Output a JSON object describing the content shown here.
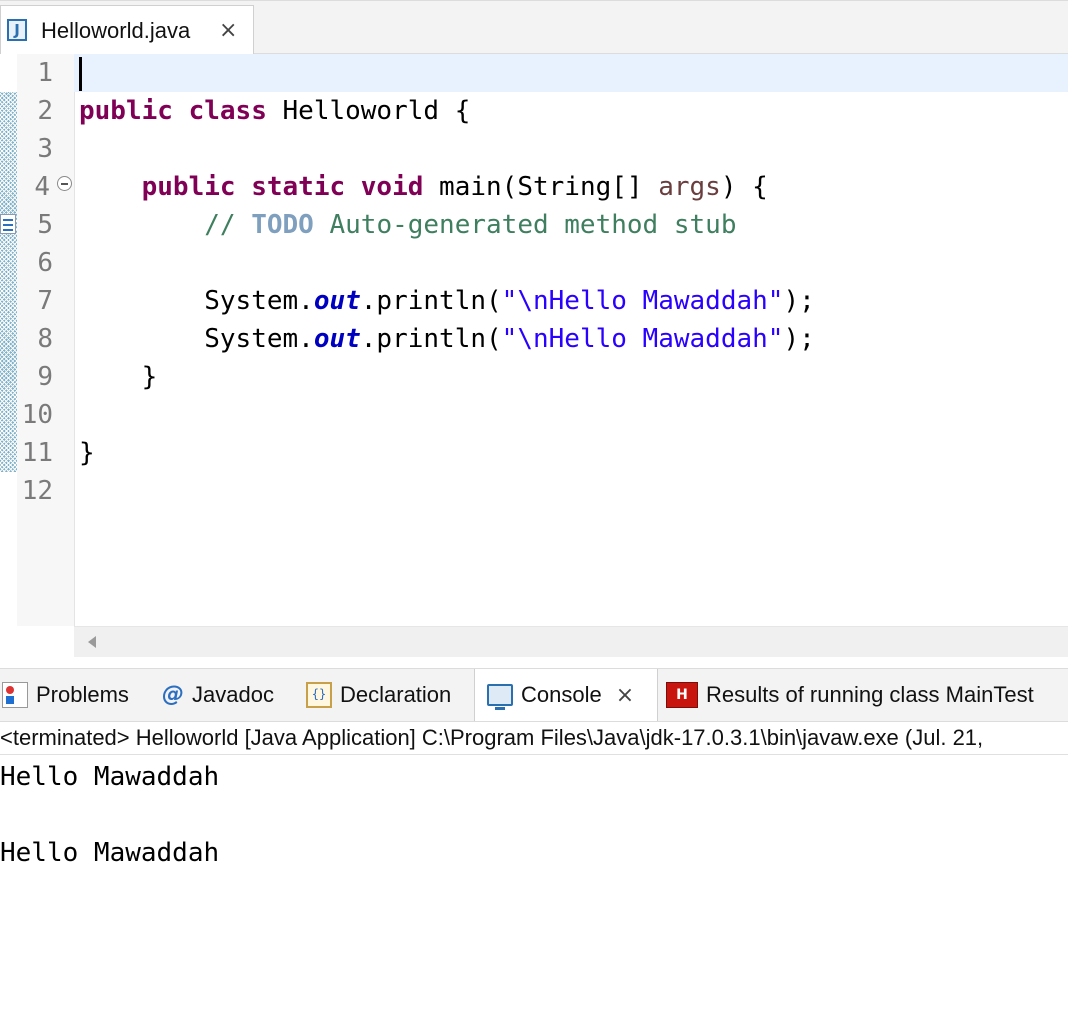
{
  "editor_tab": {
    "title": "Helloworld.java",
    "close": "×",
    "icon": "java-file-icon"
  },
  "editor": {
    "line_numbers": [
      "1",
      "2",
      "3",
      "4",
      "5",
      "6",
      "7",
      "8",
      "9",
      "10",
      "11",
      "12"
    ],
    "lines": {
      "l2": {
        "kw1": "public",
        "kw2": "class",
        "name": " Helloworld {"
      },
      "l4": {
        "kw1": "public",
        "kw2": "static",
        "kw3": "void",
        "sig": " main(String[] ",
        "param": "args",
        "end": ") {"
      },
      "l5": {
        "comment_start": "// ",
        "todo": "TODO",
        "comment_rest": " Auto-generated method stub"
      },
      "l7": {
        "pre": "System.",
        "field": "out",
        "call": ".println(",
        "string": "\"\\nHello Mawaddah\"",
        "end": ");"
      },
      "l8": {
        "pre": "System.",
        "field": "out",
        "call": ".println(",
        "string": "\"\\nHello Mawaddah\"",
        "end": ");"
      },
      "l9": "}",
      "l11": "}"
    }
  },
  "views": {
    "tabs": [
      {
        "label": "Problems",
        "icon": "problems-icon"
      },
      {
        "label": "Javadoc",
        "icon": "javadoc-icon",
        "glyph": "@"
      },
      {
        "label": "Declaration",
        "icon": "declaration-icon",
        "glyph": "{}"
      },
      {
        "label": "Console",
        "icon": "console-icon",
        "close": "×"
      },
      {
        "label": "Results of running class MainTest",
        "icon": "results-icon",
        "glyph": "H"
      }
    ]
  },
  "console": {
    "header": "<terminated> Helloworld [Java Application] C:\\Program Files\\Java\\jdk-17.0.3.1\\bin\\javaw.exe  (Jul. 21,",
    "output": [
      "Hello Mawaddah",
      "",
      "Hello Mawaddah"
    ]
  }
}
